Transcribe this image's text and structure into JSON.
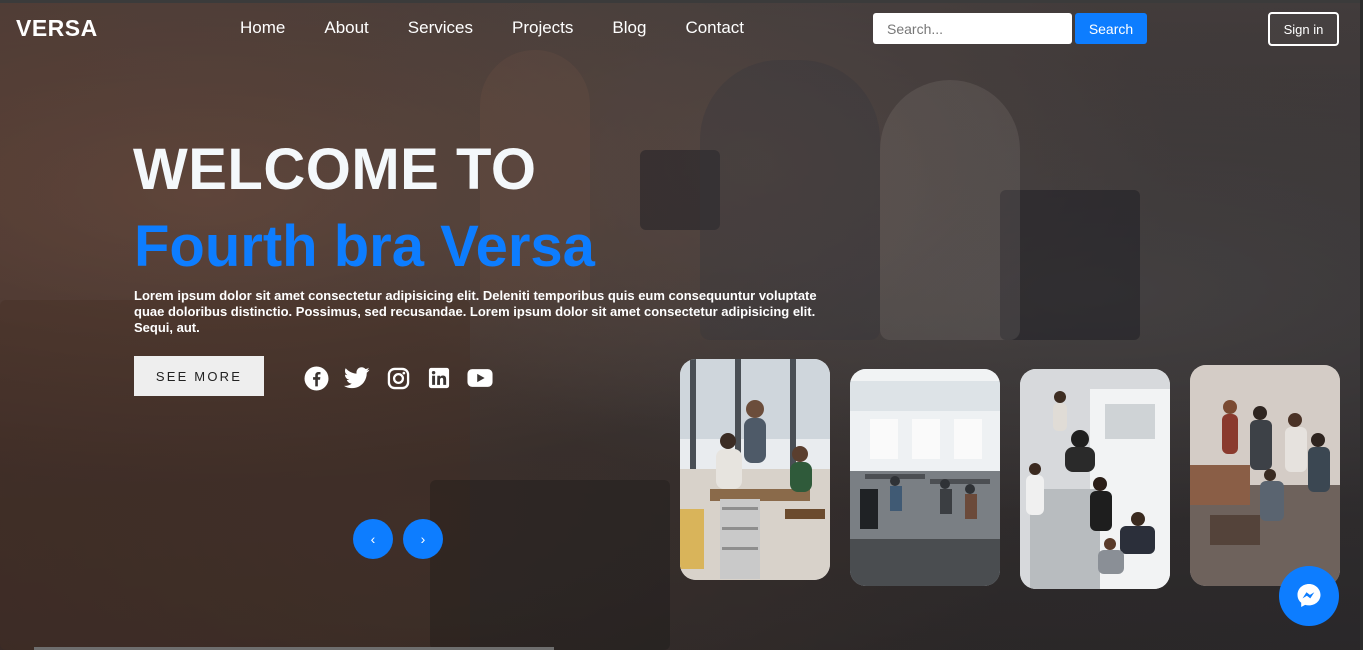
{
  "header": {
    "logo": "VERSA",
    "nav": [
      "Home",
      "About",
      "Services",
      "Projects",
      "Blog",
      "Contact"
    ],
    "search_placeholder": "Search...",
    "search_button": "Search",
    "signin_button": "Sign in"
  },
  "hero": {
    "title_line1": "WELCOME TO",
    "title_line2": "Fourth bra Versa",
    "lede": "Lorem ipsum dolor sit amet consectetur adipisicing elit. Deleniti temporibus quis eum consequuntur voluptate quae doloribus distinctio. Possimus, sed recusandae. Lorem ipsum dolor sit amet consectetur adipisicing elit. Sequi, aut.",
    "cta": "SEE MORE",
    "socials": [
      "facebook-icon",
      "twitter-icon",
      "instagram-icon",
      "linkedin-icon",
      "youtube-icon"
    ]
  },
  "slider": {
    "prev": "‹",
    "next": "›"
  },
  "colors": {
    "accent": "#0d7dff",
    "title": "#f4f8fb"
  }
}
